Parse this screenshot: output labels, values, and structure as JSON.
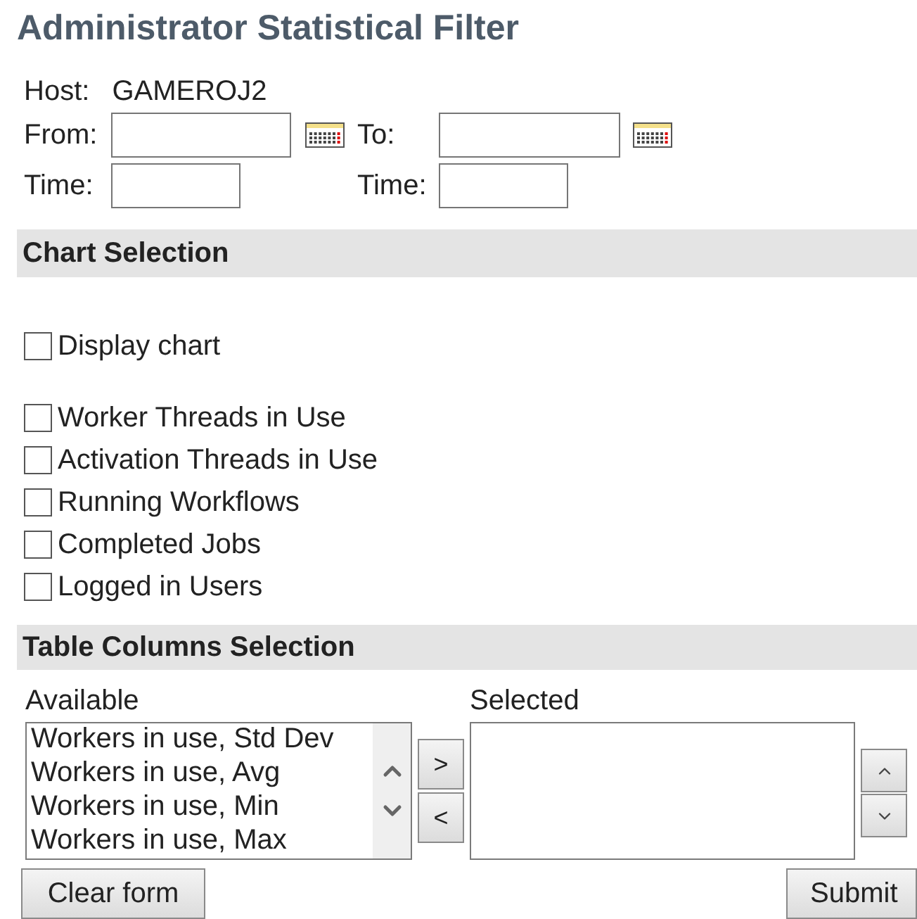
{
  "title": "Administrator Statistical Filter",
  "host": {
    "label": "Host:",
    "value": "GAMEROJ2"
  },
  "from": {
    "label": "From:"
  },
  "to": {
    "label": "To:"
  },
  "from_time": {
    "label": "Time:"
  },
  "to_time": {
    "label": "Time:"
  },
  "chart_section": {
    "title": "Chart Selection",
    "display": {
      "label": "Display chart",
      "checked": false
    },
    "series": [
      {
        "label": "Worker Threads in Use",
        "checked": false
      },
      {
        "label": "Activation Threads in Use",
        "checked": false
      },
      {
        "label": "Running Workflows",
        "checked": false
      },
      {
        "label": "Completed Jobs",
        "checked": false
      },
      {
        "label": "Logged in Users",
        "checked": false
      }
    ]
  },
  "table_section": {
    "title": "Table Columns Selection",
    "available_label": "Available",
    "selected_label": "Selected",
    "available": [
      "Workers in use, Std Dev",
      "Workers in use, Avg",
      "Workers in use, Min",
      "Workers in use, Max"
    ],
    "add_button": ">",
    "remove_button": "<"
  },
  "buttons": {
    "clear": "Clear form",
    "submit": "Submit"
  }
}
